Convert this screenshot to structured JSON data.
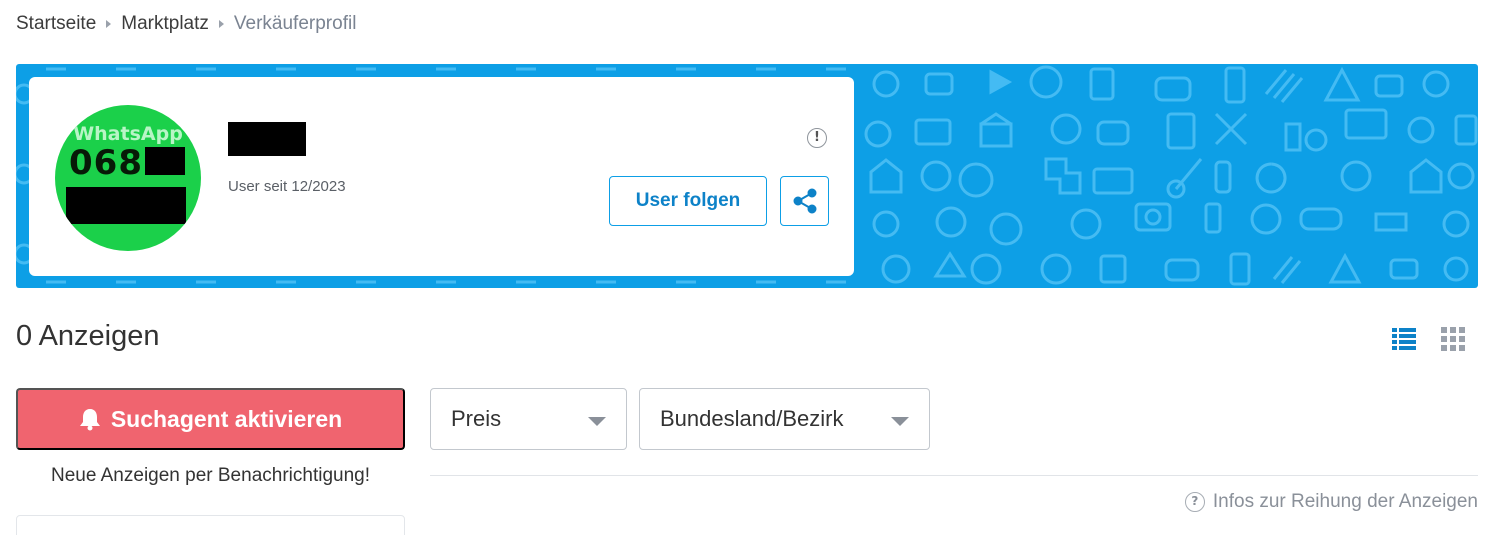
{
  "breadcrumb": {
    "items": [
      "Startseite",
      "Marktplatz",
      "Verkäuferprofil"
    ]
  },
  "banner": {
    "color": "#0d9fe6",
    "pattern_icon_color": "#4fc0f5"
  },
  "profile": {
    "avatar_label": "WhatsApp",
    "avatar_number": "0681",
    "avatar_color": "#1bd04a",
    "member_since": "User seit 12/2023",
    "info_icon": "!",
    "follow_label": "User folgen",
    "share_icon": "share-icon"
  },
  "listing": {
    "count_label": "0 Anzeigen",
    "view_list_icon": "list-view-icon",
    "view_grid_icon": "grid-view-icon"
  },
  "search_agent": {
    "button_label": "Suchagent aktivieren",
    "subtext": "Neue Anzeigen per Benachrichtigung!",
    "button_color": "#f0646f",
    "icon": "bell-icon"
  },
  "filters": {
    "price_label": "Preis",
    "region_label": "Bundesland/Bezirk"
  },
  "ranking": {
    "help_icon": "?",
    "label": "Infos zur Reihung der Anzeigen"
  }
}
